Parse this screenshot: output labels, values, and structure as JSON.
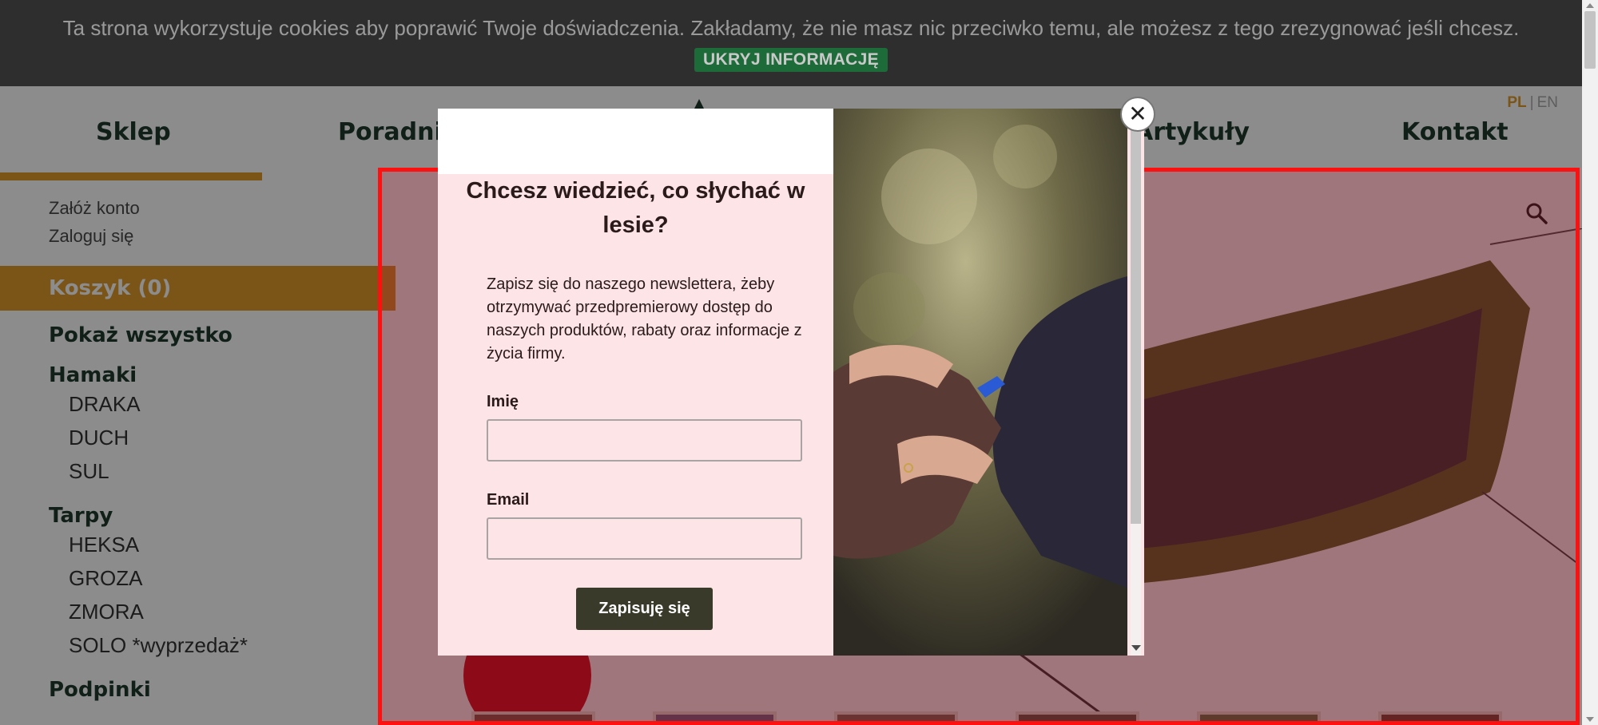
{
  "cookie_bar": {
    "text": "Ta strona wykorzystuje cookies aby poprawić Twoje doświadczenia. Zakładamy, że nie masz nic przeciwko temu, ale możesz z tego zrezygnować jeśli chcesz.",
    "button": "UKRYJ INFORMACJĘ"
  },
  "nav": {
    "items": [
      "Sklep",
      "Poradnik",
      "Artykuły",
      "Kontakt"
    ],
    "active": "Sklep"
  },
  "lang": {
    "pl": "PL",
    "separator": "|",
    "en": "EN",
    "active": "PL"
  },
  "account": {
    "register": "Załóż konto",
    "login": "Zaloguj się"
  },
  "cart": {
    "label": "Koszyk (0)"
  },
  "catalog": {
    "show_all": "Pokaż wszystko",
    "groups": [
      {
        "name": "Hamaki",
        "items": [
          "DRAKA",
          "DUCH",
          "SUL"
        ]
      },
      {
        "name": "Tarpy",
        "items": [
          "HEKSA",
          "GROZA",
          "ZMORA",
          "SOLO *wyprzedaż*"
        ]
      },
      {
        "name": "Podpinki",
        "items": []
      }
    ]
  },
  "modal": {
    "title": "Chcesz wiedzieć, co słychać w lesie?",
    "description": "Zapisz się do naszego newslettera, żeby otrzymywać przedpremierowy dostęp do naszych produktów, rabaty oraz informacje z życia firmy.",
    "name_label": "Imię",
    "name_value": "",
    "email_label": "Email",
    "email_value": "",
    "submit": "Zapisuję się",
    "close": "✕"
  },
  "colors": {
    "accent": "#e09a2a",
    "brand_dark": "#1f3a2e",
    "cookie_button": "#1e6b3a",
    "modal_bg": "#fde4e6",
    "submit_bg": "#3a3a2a",
    "highlight": "#ff1010"
  },
  "icons": {
    "search": "search-icon",
    "close": "close-icon",
    "logo": "tree-logo-icon"
  }
}
